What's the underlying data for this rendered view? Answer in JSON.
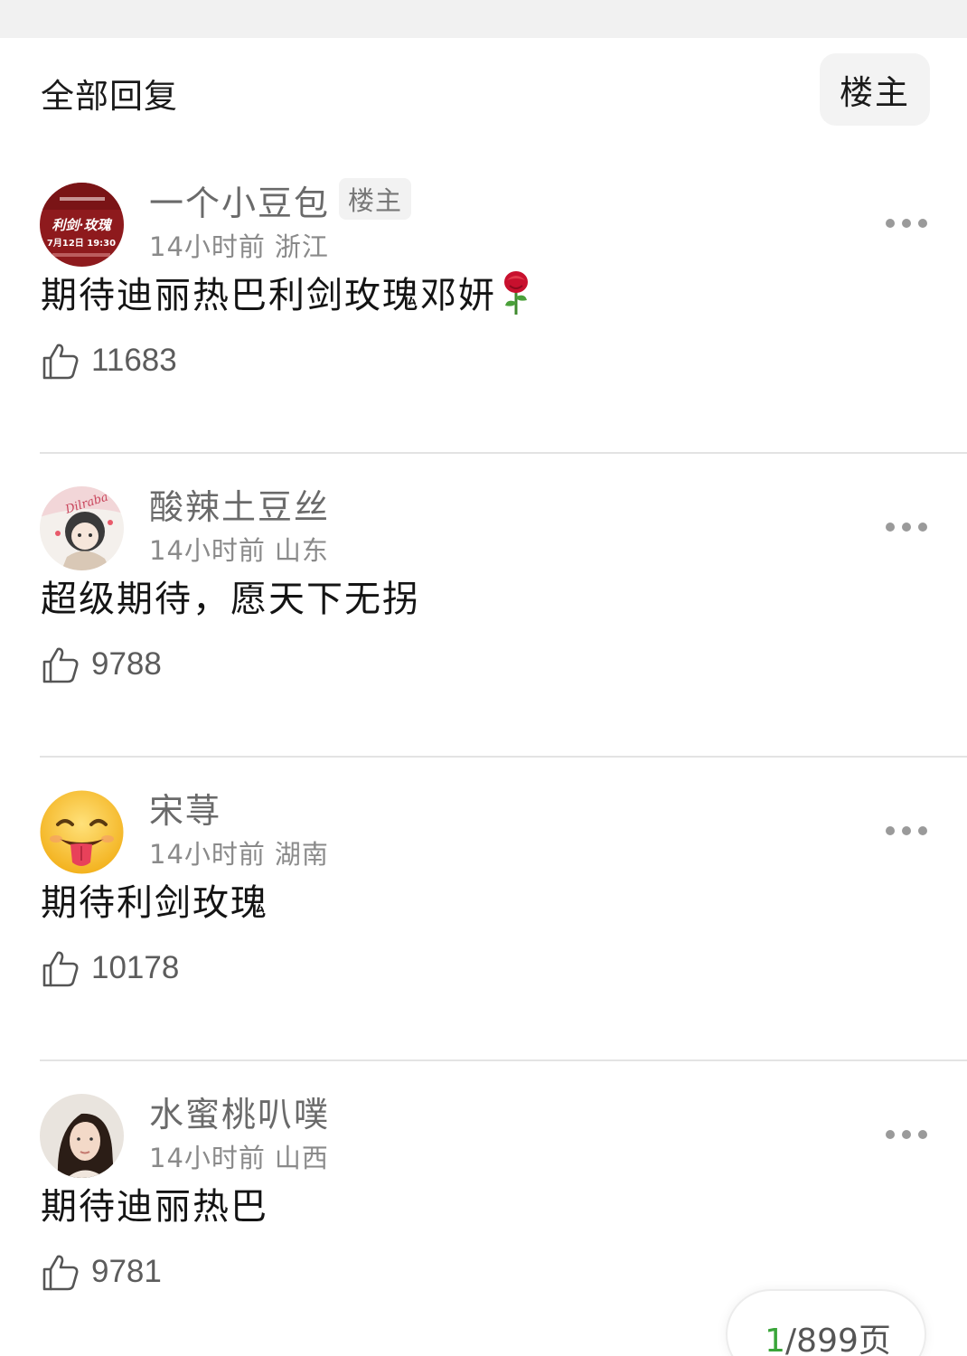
{
  "header": {
    "title": "全部回复",
    "op_filter_label": "楼主"
  },
  "comments": [
    {
      "username": "一个小豆包",
      "badge": "楼主",
      "time": "14小时前",
      "location": "浙江",
      "text": "期待迪丽热巴利剑玫瑰邓妍",
      "emoji": "rose",
      "likes": "11683",
      "avatar": "poster-avatar",
      "avatar_text": [
        "利剑·玫瑰",
        "7月12日 19:30"
      ]
    },
    {
      "username": "酸辣土豆丝",
      "time": "14小时前",
      "location": "山东",
      "text": "超级期待，愿天下无拐",
      "likes": "9788",
      "avatar": "cartoon-avatar",
      "avatar_text": [
        "Dilraba"
      ]
    },
    {
      "username": "宋荨",
      "time": "14小时前",
      "location": "湖南",
      "text": "期待利剑玫瑰",
      "likes": "10178",
      "avatar": "tongue-emoji-avatar"
    },
    {
      "username": "水蜜桃叭噗",
      "time": "14小时前",
      "location": "山西",
      "text": "期待迪丽热巴",
      "likes": "9781",
      "avatar": "photo-avatar"
    }
  ],
  "pager": {
    "current": "1",
    "total_suffix": "/899页"
  },
  "colors": {
    "accent_green": "#3aa53a",
    "avatar_red": "#8e1a1d"
  }
}
